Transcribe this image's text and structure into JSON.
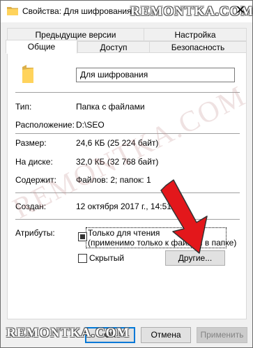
{
  "window": {
    "title": "Свойства: Для шифрования",
    "close_glyph": "✕"
  },
  "watermark": {
    "text": "REMONTKA.COM"
  },
  "tabs_row1": [
    {
      "label": "Предыдущие версии"
    },
    {
      "label": "Настройка"
    }
  ],
  "tabs_row2": [
    {
      "label": "Общие",
      "active": true
    },
    {
      "label": "Доступ"
    },
    {
      "label": "Безопасность"
    }
  ],
  "general": {
    "folder_name": "Для шифрования",
    "type_label": "Тип:",
    "type_value": "Папка с файлами",
    "location_label": "Расположение:",
    "location_value": "D:\\SEO",
    "size_label": "Размер:",
    "size_value": "24,6 КБ (25 224 байт)",
    "disk_size_label": "На диске:",
    "disk_size_value": "32,0 КБ (32 768 байт)",
    "contains_label": "Содержит:",
    "contains_value": "Файлов: 2; папок: 1",
    "created_label": "Создан:",
    "created_value": "12 октября 2017 г., 14:51"
  },
  "attributes": {
    "label": "Атрибуты:",
    "readonly_line1": "Только для чтения",
    "readonly_line2": "(применимо только к файлам в папке)",
    "readonly_state": "indeterminate",
    "hidden_label": "Скрытый",
    "hidden_checked": false,
    "advanced_button": "Другие..."
  },
  "footer": {
    "ok": "ОК",
    "cancel": "Отмена",
    "apply": "Применить"
  },
  "colors": {
    "folder": "#ffd35c",
    "arrow": "#e3171b",
    "default_button_border": "#0078d7"
  }
}
